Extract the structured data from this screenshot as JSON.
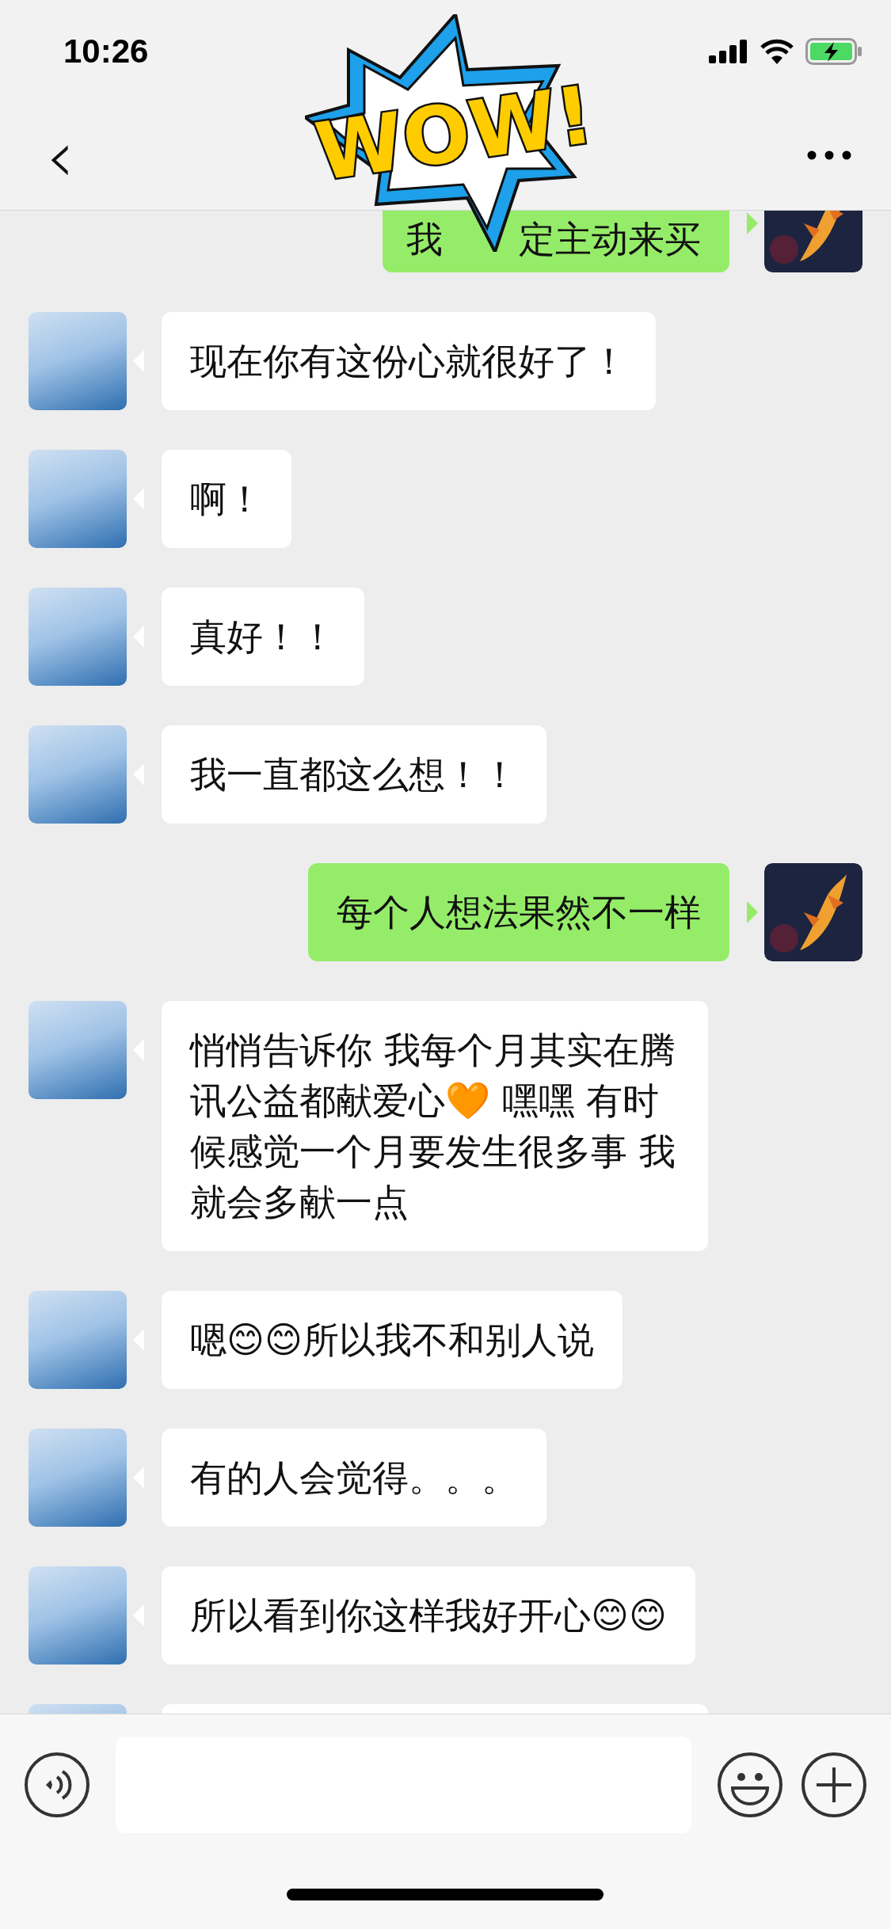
{
  "status_bar": {
    "time": "10:26"
  },
  "nav": {
    "back": "‹"
  },
  "sticker": {
    "text": "WOW!"
  },
  "messages": [
    {
      "kind": "sent",
      "parts": [
        "我",
        "定主动来买"
      ]
    },
    {
      "kind": "received",
      "text": "现在你有这份心就很好了！"
    },
    {
      "kind": "received",
      "text": "啊！"
    },
    {
      "kind": "received",
      "text": "真好！！"
    },
    {
      "kind": "received",
      "text": "我一直都这么想！！"
    },
    {
      "kind": "sent",
      "text": "每个人想法果然不一样"
    },
    {
      "kind": "received",
      "text": "悄悄告诉你 我每个月其实在腾讯公益都献爱心🧡 嘿嘿 有时候感觉一个月要发生很多事 我就会多献一点"
    },
    {
      "kind": "received",
      "text": "嗯😊😊所以我不和别人说"
    },
    {
      "kind": "received",
      "text": "有的人会觉得。。。"
    },
    {
      "kind": "received",
      "text": "所以看到你这样我好开心😊😊"
    },
    {
      "kind": "received"
    }
  ]
}
